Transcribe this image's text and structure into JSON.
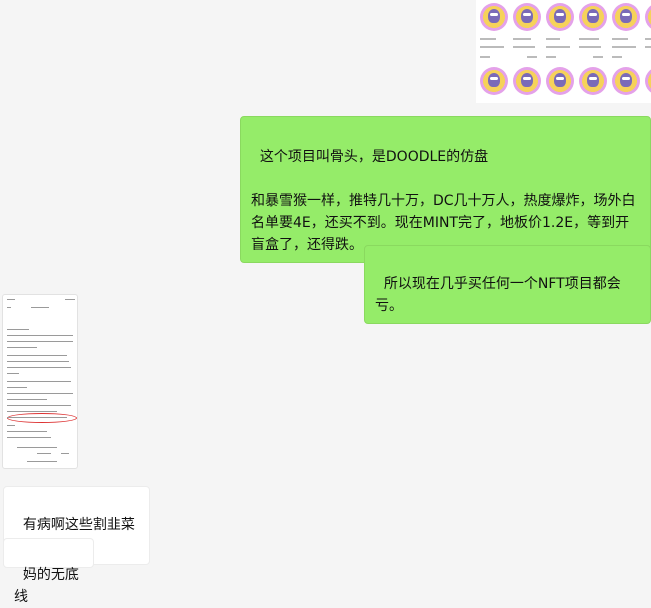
{
  "messages": [
    {
      "side": "right",
      "text": "这个项目叫骨头，是DOODLE的仿盘\n\n和暴雪猴一样，推特几十万，DC几十万人，热度爆炸，场外白名单要4E，还买不到。现在MINT完了，地板价1.2E，等到开盲盒了，还得跌。"
    },
    {
      "side": "right",
      "text": "所以现在几乎买任何一个NFT项目都会亏。"
    },
    {
      "side": "left",
      "text": "有病啊这些割韭菜的"
    },
    {
      "side": "left",
      "text": "妈的无底线"
    }
  ],
  "images": [
    {
      "name": "nft-collection-screenshot",
      "side": "right"
    },
    {
      "name": "phone-screenshot",
      "side": "left"
    }
  ],
  "colors": {
    "bubble_right": "#95ec69",
    "bubble_left": "#ffffff",
    "background": "#f5f5f5"
  }
}
